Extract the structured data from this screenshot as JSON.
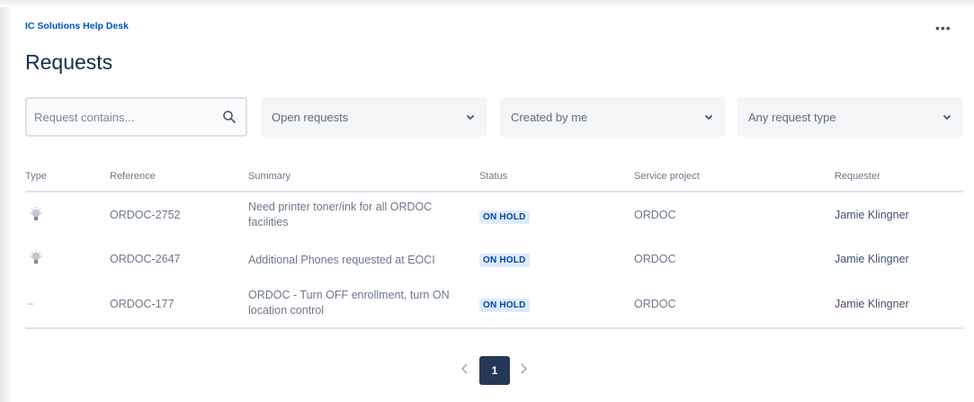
{
  "breadcrumb": "IC Solutions Help Desk",
  "page_title": "Requests",
  "more_icon": "more-horizontal-icon",
  "more_label": "•••",
  "filters": {
    "search_placeholder": "Request contains...",
    "status_select": "Open requests",
    "creator_select": "Created by me",
    "type_select": "Any request type"
  },
  "table": {
    "columns": [
      "Type",
      "Reference",
      "Summary",
      "Status",
      "Service project",
      "Requester"
    ],
    "rows": [
      {
        "type_icon": "lightbulb-icon",
        "reference": "ORDOC-2752",
        "summary": "Need printer toner/ink for all ORDOC facilities",
        "status": "ON HOLD",
        "project": "ORDOC",
        "requester": "Jamie Klingner"
      },
      {
        "type_icon": "lightbulb-icon",
        "reference": "ORDOC-2647",
        "summary": "Additional Phones requested at EOCI",
        "status": "ON HOLD",
        "project": "ORDOC",
        "requester": "Jamie Klingner"
      },
      {
        "type_icon": "none",
        "type_text": "--",
        "reference": "ORDOC-177",
        "summary": "ORDOC - Turn OFF enrollment, turn ON location control",
        "status": "ON HOLD",
        "project": "ORDOC",
        "requester": "Jamie Klingner"
      }
    ]
  },
  "pagination": {
    "current_page": "1"
  },
  "colors": {
    "link": "#0052cc",
    "lozenge_bg": "#deebff",
    "lozenge_text": "#0747a6",
    "pager_active": "#253858"
  }
}
